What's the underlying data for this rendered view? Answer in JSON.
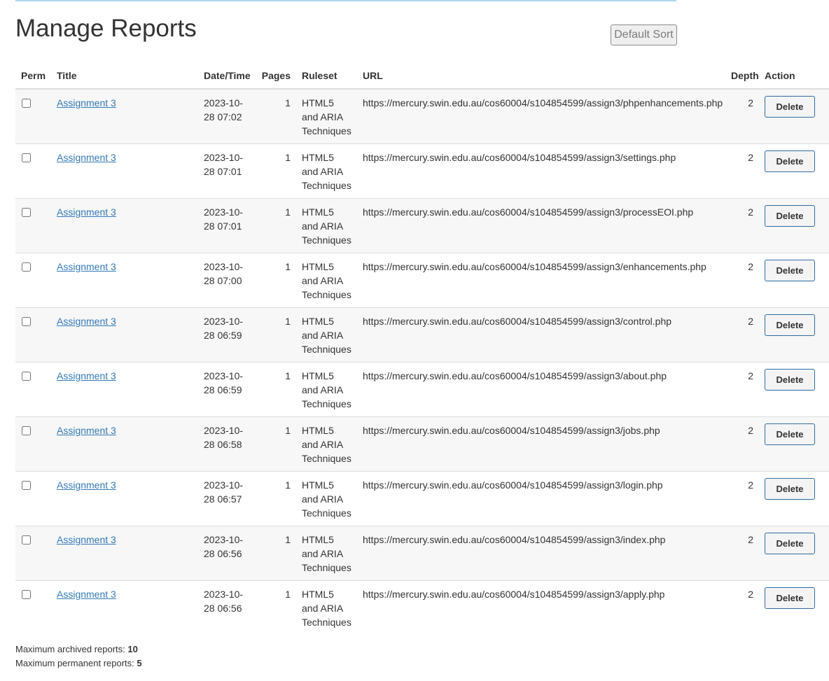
{
  "page": {
    "title": "Manage Reports",
    "default_sort_label": "Default Sort"
  },
  "table": {
    "headers": {
      "perm": "Perm",
      "title": "Title",
      "datetime": "Date/Time",
      "pages": "Pages",
      "ruleset": "Ruleset",
      "url": "URL",
      "depth": "Depth",
      "action": "Action"
    },
    "rows": [
      {
        "title": "Assignment 3",
        "date": "2023-10-",
        "time": "28 07:02",
        "pages": "1",
        "ruleset": [
          "HTML5",
          "and ARIA",
          "Techniques"
        ],
        "url": "https://mercury.swin.edu.au/cos60004/s104854599/assign3/phpenhancements.php",
        "depth": "2",
        "action": "Delete"
      },
      {
        "title": "Assignment 3",
        "date": "2023-10-",
        "time": "28 07:01",
        "pages": "1",
        "ruleset": [
          "HTML5",
          "and ARIA",
          "Techniques"
        ],
        "url": "https://mercury.swin.edu.au/cos60004/s104854599/assign3/settings.php",
        "depth": "2",
        "action": "Delete"
      },
      {
        "title": "Assignment 3",
        "date": "2023-10-",
        "time": "28 07:01",
        "pages": "1",
        "ruleset": [
          "HTML5",
          "and ARIA",
          "Techniques"
        ],
        "url": "https://mercury.swin.edu.au/cos60004/s104854599/assign3/processEOI.php",
        "depth": "2",
        "action": "Delete"
      },
      {
        "title": "Assignment 3",
        "date": "2023-10-",
        "time": "28 07:00",
        "pages": "1",
        "ruleset": [
          "HTML5",
          "and ARIA",
          "Techniques"
        ],
        "url": "https://mercury.swin.edu.au/cos60004/s104854599/assign3/enhancements.php",
        "depth": "2",
        "action": "Delete"
      },
      {
        "title": "Assignment 3",
        "date": "2023-10-",
        "time": "28 06:59",
        "pages": "1",
        "ruleset": [
          "HTML5",
          "and ARIA",
          "Techniques"
        ],
        "url": "https://mercury.swin.edu.au/cos60004/s104854599/assign3/control.php",
        "depth": "2",
        "action": "Delete"
      },
      {
        "title": "Assignment 3",
        "date": "2023-10-",
        "time": "28 06:59",
        "pages": "1",
        "ruleset": [
          "HTML5",
          "and ARIA",
          "Techniques"
        ],
        "url": "https://mercury.swin.edu.au/cos60004/s104854599/assign3/about.php",
        "depth": "2",
        "action": "Delete"
      },
      {
        "title": "Assignment 3",
        "date": "2023-10-",
        "time": "28 06:58",
        "pages": "1",
        "ruleset": [
          "HTML5",
          "and ARIA",
          "Techniques"
        ],
        "url": "https://mercury.swin.edu.au/cos60004/s104854599/assign3/jobs.php",
        "depth": "2",
        "action": "Delete"
      },
      {
        "title": "Assignment 3",
        "date": "2023-10-",
        "time": "28 06:57",
        "pages": "1",
        "ruleset": [
          "HTML5",
          "and ARIA",
          "Techniques"
        ],
        "url": "https://mercury.swin.edu.au/cos60004/s104854599/assign3/login.php",
        "depth": "2",
        "action": "Delete"
      },
      {
        "title": "Assignment 3",
        "date": "2023-10-",
        "time": "28 06:56",
        "pages": "1",
        "ruleset": [
          "HTML5",
          "and ARIA",
          "Techniques"
        ],
        "url": "https://mercury.swin.edu.au/cos60004/s104854599/assign3/index.php",
        "depth": "2",
        "action": "Delete"
      },
      {
        "title": "Assignment 3",
        "date": "2023-10-",
        "time": "28 06:56",
        "pages": "1",
        "ruleset": [
          "HTML5",
          "and ARIA",
          "Techniques"
        ],
        "url": "https://mercury.swin.edu.au/cos60004/s104854599/assign3/apply.php",
        "depth": "2",
        "action": "Delete"
      }
    ]
  },
  "footer": {
    "max_archived_label": "Maximum archived reports: ",
    "max_archived_value": "10",
    "max_permanent_label": "Maximum permanent reports: ",
    "max_permanent_value": "5"
  },
  "colors": {
    "link": "#337ab7",
    "top_bar": "#a9d8ec",
    "row_stripe": "#f7f7f7",
    "delete_border": "#2e6da4"
  }
}
